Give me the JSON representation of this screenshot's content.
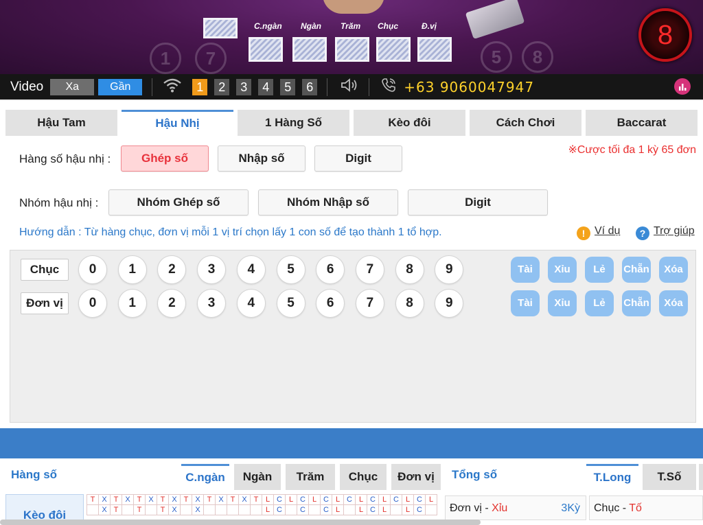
{
  "video": {
    "positions": [
      "C.ngàn",
      "Ngàn",
      "Trăm",
      "Chục",
      "Đ.vị"
    ],
    "deco_balls": [
      "1",
      "7",
      "5",
      "8"
    ],
    "countdown": "8"
  },
  "control_bar": {
    "video_label": "Video",
    "far_label": "Xa",
    "near_label": "Gần",
    "channels": [
      "1",
      "2",
      "3",
      "4",
      "5",
      "6"
    ],
    "active_channel": "1",
    "hotline": "+63 9060047947"
  },
  "tabs": [
    "Hậu Tam",
    "Hậu Nhị",
    "1 Hàng Số",
    "Kèo đôi",
    "Cách Chơi",
    "Baccarat"
  ],
  "active_tab": "Hậu Nhị",
  "bet_row": {
    "label": "Hàng số hậu nhị :",
    "options": [
      "Ghép số",
      "Nhập số",
      "Digit"
    ]
  },
  "group_row": {
    "label": "Nhóm hậu nhị :",
    "options": [
      "Nhóm Ghép số",
      "Nhóm Nhập số",
      "Digit"
    ]
  },
  "limit_note": "※Cược tối đa 1 kỳ 65 đơn",
  "guide_text": "Hướng dẫn : Từ hàng chục, đơn vị mỗi 1 vị trí chọn lấy 1 con số để tạo thành 1 tổ hợp.",
  "example_link": "Ví dụ",
  "help_link": "Trợ giúp",
  "number_rows": [
    {
      "name": "Chục",
      "digits": [
        "0",
        "1",
        "2",
        "3",
        "4",
        "5",
        "6",
        "7",
        "8",
        "9"
      ]
    },
    {
      "name": "Đơn vị",
      "digits": [
        "0",
        "1",
        "2",
        "3",
        "4",
        "5",
        "6",
        "7",
        "8",
        "9"
      ]
    }
  ],
  "quick_buttons": [
    "Tài",
    "Xỉu",
    "Lẻ",
    "Chẵn",
    "Xóa"
  ],
  "board": {
    "left_label": "Hàng số",
    "position_tabs": [
      "C.ngàn",
      "Ngàn",
      "Trăm",
      "Chục",
      "Đơn vị"
    ],
    "active_position": "C.ngàn",
    "right_label": "Tổng số",
    "stat_tabs": [
      "T.Long",
      "T.Số"
    ],
    "active_stat": "T.Long",
    "side_item": "Kèo đôi",
    "road_row1": [
      "T",
      "X",
      "T",
      "X",
      "T",
      "X",
      "T",
      "X",
      "T",
      "X",
      "T",
      "X",
      "T",
      "X",
      "T",
      "L",
      "C",
      "L",
      "C",
      "L",
      "C",
      "L",
      "C",
      "L",
      "C",
      "L",
      "C",
      "L",
      "C",
      "L"
    ],
    "road_row2": [
      "",
      "X",
      "T",
      "",
      "T",
      "",
      "T",
      "X",
      "",
      "X",
      "",
      "",
      "",
      "",
      "",
      "L",
      "C",
      "",
      "C",
      "",
      "C",
      "L",
      "",
      "L",
      "C",
      "L",
      "",
      "L",
      "C",
      ""
    ],
    "summary1": {
      "label": "Đơn vị - ",
      "value": "Xỉu",
      "count": "3Kỳ"
    },
    "summary2": {
      "label": "Chục - ",
      "value": "Tố"
    }
  },
  "colors": {
    "accent_blue": "#2c74c9",
    "selected_red": "#e8323c",
    "hotline_yellow": "#ffd22b",
    "channel_orange": "#f09a1a"
  }
}
